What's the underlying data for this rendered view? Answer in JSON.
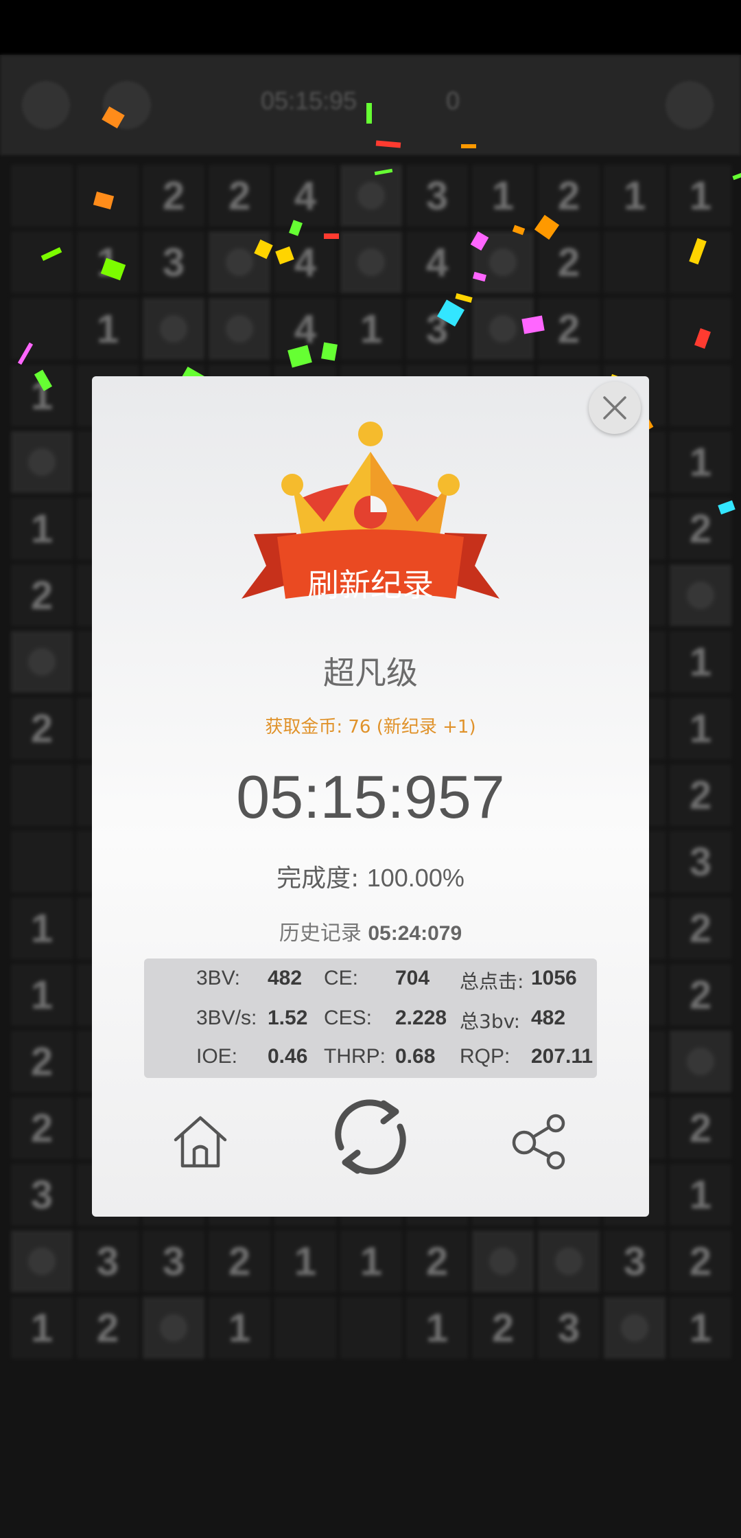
{
  "topbar": {
    "timer": "05:15:95",
    "flags": "0"
  },
  "board": {
    "rows": [
      [
        "",
        "",
        "2",
        "2",
        "4",
        "*",
        "3",
        "1",
        "2",
        "1",
        "1"
      ],
      [
        "",
        "1",
        "3",
        "*",
        "4",
        "*",
        "4",
        "*",
        "2",
        "",
        ""
      ],
      [
        "",
        "1",
        "*",
        "*",
        "4",
        "1",
        "3",
        "*",
        "2",
        "",
        ""
      ],
      [
        "1",
        "",
        "",
        "",
        "",
        "",
        "",
        "",
        "",
        "",
        ""
      ],
      [
        "*",
        "",
        "",
        "",
        "",
        "",
        "",
        "",
        "",
        "",
        "1"
      ],
      [
        "1",
        "",
        "",
        "",
        "",
        "",
        "",
        "",
        "",
        "",
        "2"
      ],
      [
        "2",
        "",
        "",
        "",
        "",
        "",
        "",
        "",
        "",
        "",
        "*"
      ],
      [
        "*",
        "",
        "",
        "",
        "",
        "",
        "",
        "",
        "",
        "",
        "1"
      ],
      [
        "2",
        "",
        "",
        "",
        "",
        "",
        "",
        "",
        "",
        "",
        "1"
      ],
      [
        "",
        "",
        "",
        "",
        "",
        "",
        "",
        "",
        "",
        "",
        "2"
      ],
      [
        "",
        "",
        "",
        "",
        "",
        "",
        "",
        "",
        "",
        "",
        "3"
      ],
      [
        "1",
        "",
        "",
        "",
        "",
        "",
        "",
        "",
        "",
        "",
        "2"
      ],
      [
        "1",
        "",
        "",
        "",
        "",
        "",
        "",
        "",
        "",
        "",
        "2"
      ],
      [
        "2",
        "",
        "",
        "",
        "",
        "",
        "",
        "",
        "",
        "",
        "*"
      ],
      [
        "2",
        "",
        "",
        "",
        "",
        "",
        "",
        "",
        "",
        "",
        "2"
      ],
      [
        "3",
        "",
        "",
        "",
        "",
        "",
        "",
        "",
        "",
        "",
        "1"
      ],
      [
        "*",
        "3",
        "3",
        "2",
        "1",
        "1",
        "2",
        "*",
        "*",
        "3",
        "2"
      ],
      [
        "1",
        "2",
        "*",
        "1",
        "",
        "",
        "1",
        "2",
        "3",
        "*",
        "1"
      ]
    ]
  },
  "dialog": {
    "banner": "刷新纪录",
    "level": "超凡级",
    "coins": "获取金币: 76 (新纪录 +1)",
    "time": "05:15:957",
    "completion_label": "完成度:",
    "completion_value": "100.00%",
    "history_label": "历史记录",
    "history_value": "05:24:079",
    "stats": {
      "bbbv_label": "3BV:",
      "bbbv_value": "482",
      "ce_label": "CE:",
      "ce_value": "704",
      "clicks_label": "总点击:",
      "clicks_value": "1056",
      "bbbvs_label": "3BV/s:",
      "bbbvs_value": "1.52",
      "ces_label": "CES:",
      "ces_value": "2.228",
      "total3bv_label": "总3bv:",
      "total3bv_value": "482",
      "ioe_label": "IOE:",
      "ioe_value": "0.46",
      "thrp_label": "THRP:",
      "thrp_value": "0.68",
      "rqp_label": "RQP:",
      "rqp_value": "207.11"
    },
    "icons": {
      "home": "home-icon",
      "retry": "refresh-icon",
      "share": "share-icon",
      "close": "close-icon"
    }
  },
  "colors": {
    "accent": "#e0922a",
    "banner": "#e8401f",
    "crown": "#f4b82c"
  }
}
